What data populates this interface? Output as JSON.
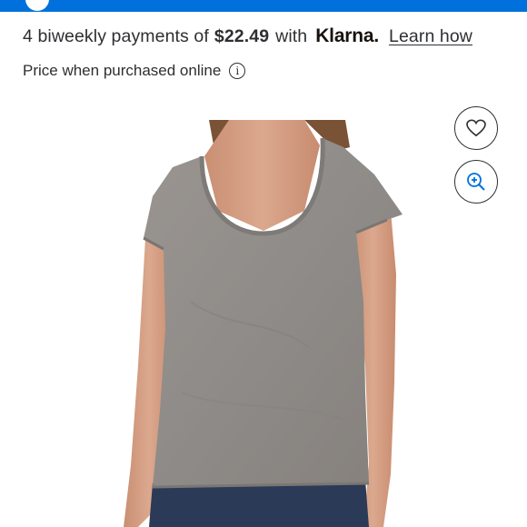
{
  "payment": {
    "prefix": "4 biweekly payments of",
    "amount": "$22.49",
    "with_text": "with",
    "provider": "Klarna.",
    "learn_link": "Learn how"
  },
  "price_note": "Price when purchased online",
  "icons": {
    "info": "info-icon",
    "favorite": "heart-icon",
    "zoom": "zoom-in-icon"
  },
  "colors": {
    "brand_blue": "#0071dc",
    "text": "#2e2f32",
    "shirt_gray": "#8f8b88",
    "jeans": "#2b3a57"
  }
}
